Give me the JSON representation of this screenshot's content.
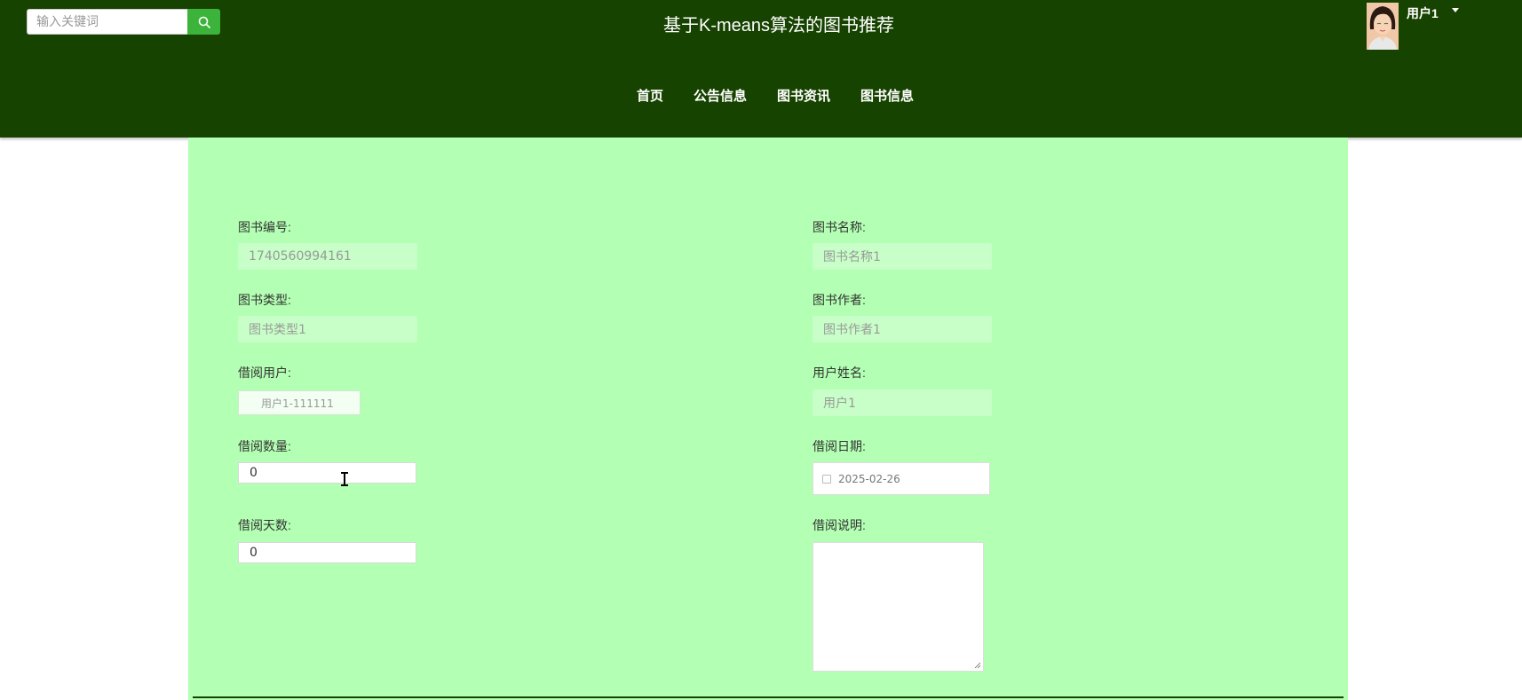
{
  "header": {
    "search_placeholder": "输入关键词",
    "site_title": "基于K-means算法的图书推荐",
    "user_name": "用户1"
  },
  "nav": {
    "items": [
      {
        "label": "首页"
      },
      {
        "label": "公告信息"
      },
      {
        "label": "图书资讯"
      },
      {
        "label": "图书信息"
      }
    ]
  },
  "form": {
    "book_id": {
      "label": "图书编号:",
      "value": "1740560994161"
    },
    "book_name": {
      "label": "图书名称:",
      "value": "图书名称1"
    },
    "book_type": {
      "label": "图书类型:",
      "value": "图书类型1"
    },
    "book_author": {
      "label": "图书作者:",
      "value": "图书作者1"
    },
    "borrow_user": {
      "label": "借阅用户:",
      "value": "用户1-111111"
    },
    "user_name": {
      "label": "用户姓名:",
      "value": "用户1"
    },
    "borrow_quantity": {
      "label": "借阅数量:",
      "value": "0"
    },
    "borrow_date": {
      "label": "借阅日期:",
      "value": "2025-02-26"
    },
    "borrow_days": {
      "label": "借阅天数:",
      "value": "0"
    },
    "borrow_note": {
      "label": "借阅说明:",
      "value": ""
    }
  },
  "colors": {
    "header_bg": "#174300",
    "panel_bg": "#b3ffb3",
    "search_button": "#3cb43c"
  }
}
